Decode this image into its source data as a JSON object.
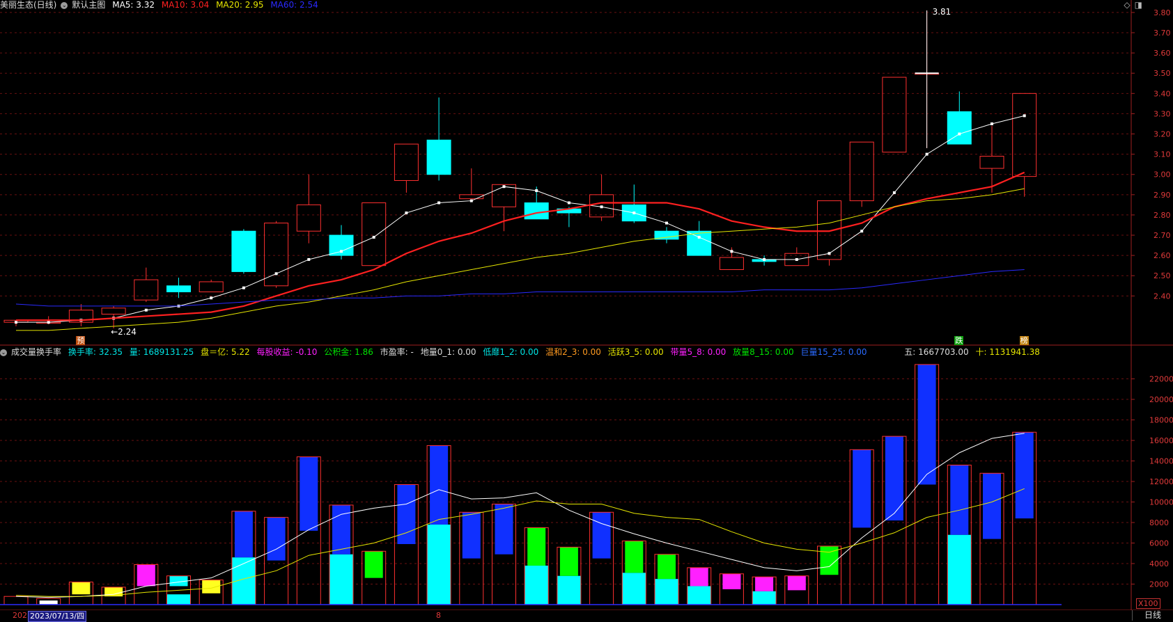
{
  "header": {
    "title": "美丽生态(日线)",
    "main_chart_label": "默认主图",
    "ma": [
      {
        "label": "MA5: 3.32",
        "color": "#ffffff"
      },
      {
        "label": "MA10: 3.04",
        "color": "#ff2020"
      },
      {
        "label": "MA20: 2.95",
        "color": "#e6e600"
      },
      {
        "label": "MA60: 2.54",
        "color": "#2a2aff"
      }
    ]
  },
  "volume_header": {
    "title": "成交量换手率",
    "items": [
      {
        "label": "换手率: 32.35",
        "color": "#00e5e5"
      },
      {
        "label": "量: 1689131.25",
        "color": "#00e5e5"
      },
      {
        "label": "盘＝亿: 5.22",
        "color": "#e6e600"
      },
      {
        "label": "每股收益: -0.10",
        "color": "#ff20ff"
      },
      {
        "label": "公积金: 1.86",
        "color": "#00e500"
      },
      {
        "label": "市盈率: -",
        "color": "#dddddd"
      },
      {
        "label": "地量0_1: 0.00",
        "color": "#dddddd"
      },
      {
        "label": "低靡1_2: 0.00",
        "color": "#00e5e5"
      },
      {
        "label": "温和2_3: 0.00",
        "color": "#ff9a20"
      },
      {
        "label": "活跃3_5: 0.00",
        "color": "#e6e600"
      },
      {
        "label": "带量5_8: 0.00",
        "color": "#ff20ff"
      },
      {
        "label": "放量8_15: 0.00",
        "color": "#00e500"
      },
      {
        "label": "巨量15_25: 0.00",
        "color": "#2a6aff"
      }
    ],
    "extra": [
      {
        "label": "五: 1667703.00",
        "color": "#dddddd"
      },
      {
        "label": "十: 1131941.38",
        "color": "#e6e600"
      }
    ]
  },
  "bottom": {
    "date": "2023/07/13/四",
    "left_partial": "202",
    "mid_mark": "8",
    "daily": "日线",
    "multiplier": "X100"
  },
  "markers": [
    {
      "text": "预",
      "bg": "#c05010",
      "index": 2
    },
    {
      "text": "跌",
      "bg": "#10a010",
      "index": 29
    },
    {
      "text": "榜",
      "bg": "#c08010",
      "index": 31
    }
  ],
  "chart_data": [
    {
      "type": "candlestick",
      "y_ticks": [
        2.4,
        2.5,
        2.6,
        2.7,
        2.8,
        2.9,
        3.0,
        3.1,
        3.2,
        3.3,
        3.4,
        3.5,
        3.6,
        3.7,
        3.8
      ],
      "ylim": [
        2.24,
        3.84
      ],
      "annotations": [
        {
          "text": "3.81",
          "index": 28
        },
        {
          "text": "2.24",
          "index": 3
        }
      ],
      "candles": [
        {
          "o": 2.27,
          "c": 2.28,
          "h": 2.28,
          "l": 2.25
        },
        {
          "o": 2.27,
          "c": 2.27,
          "h": 2.3,
          "l": 2.26
        },
        {
          "o": 2.27,
          "c": 2.33,
          "h": 2.36,
          "l": 2.25
        },
        {
          "o": 2.31,
          "c": 2.34,
          "h": 2.35,
          "l": 2.24
        },
        {
          "o": 2.38,
          "c": 2.48,
          "h": 2.54,
          "l": 2.37
        },
        {
          "o": 2.45,
          "c": 2.42,
          "h": 2.49,
          "l": 2.39
        },
        {
          "o": 2.42,
          "c": 2.47,
          "h": 2.48,
          "l": 2.42
        },
        {
          "o": 2.72,
          "c": 2.52,
          "h": 2.73,
          "l": 2.51
        },
        {
          "o": 2.45,
          "c": 2.76,
          "h": 2.77,
          "l": 2.44
        },
        {
          "o": 2.72,
          "c": 2.85,
          "h": 3.0,
          "l": 2.66
        },
        {
          "o": 2.7,
          "c": 2.6,
          "h": 2.75,
          "l": 2.58
        },
        {
          "o": 2.55,
          "c": 2.86,
          "h": 2.86,
          "l": 2.55
        },
        {
          "o": 2.97,
          "c": 3.15,
          "h": 3.15,
          "l": 2.91
        },
        {
          "o": 3.17,
          "c": 3.0,
          "h": 3.38,
          "l": 2.97
        },
        {
          "o": 2.88,
          "c": 2.9,
          "h": 3.03,
          "l": 2.88
        },
        {
          "o": 2.84,
          "c": 2.95,
          "h": 2.95,
          "l": 2.72
        },
        {
          "o": 2.86,
          "c": 2.78,
          "h": 2.94,
          "l": 2.78
        },
        {
          "o": 2.83,
          "c": 2.81,
          "h": 2.84,
          "l": 2.74
        },
        {
          "o": 2.79,
          "c": 2.9,
          "h": 3.0,
          "l": 2.77
        },
        {
          "o": 2.85,
          "c": 2.77,
          "h": 2.95,
          "l": 2.76
        },
        {
          "o": 2.72,
          "c": 2.68,
          "h": 2.74,
          "l": 2.66
        },
        {
          "o": 2.72,
          "c": 2.6,
          "h": 2.77,
          "l": 2.6
        },
        {
          "o": 2.53,
          "c": 2.59,
          "h": 2.64,
          "l": 2.53
        },
        {
          "o": 2.58,
          "c": 2.57,
          "h": 2.6,
          "l": 2.55
        },
        {
          "o": 2.55,
          "c": 2.61,
          "h": 2.64,
          "l": 2.55
        },
        {
          "o": 2.58,
          "c": 2.87,
          "h": 2.87,
          "l": 2.55
        },
        {
          "o": 2.87,
          "c": 3.16,
          "h": 3.16,
          "l": 2.84
        },
        {
          "o": 3.11,
          "c": 3.48,
          "h": 3.48,
          "l": 3.11
        },
        {
          "o": 3.5,
          "c": 3.5,
          "h": 3.81,
          "l": 3.13
        },
        {
          "o": 3.31,
          "c": 3.15,
          "h": 3.41,
          "l": 3.15
        },
        {
          "o": 3.03,
          "c": 3.09,
          "h": 3.24,
          "l": 2.91
        },
        {
          "o": 2.99,
          "c": 3.4,
          "h": 3.4,
          "l": 2.89
        }
      ],
      "series": [
        {
          "name": "MA5",
          "color": "#ffffff",
          "values": [
            2.27,
            2.27,
            2.28,
            2.29,
            2.33,
            2.35,
            2.39,
            2.44,
            2.51,
            2.58,
            2.62,
            2.69,
            2.81,
            2.86,
            2.87,
            2.94,
            2.92,
            2.86,
            2.84,
            2.81,
            2.76,
            2.69,
            2.62,
            2.58,
            2.58,
            2.61,
            2.72,
            2.91,
            3.1,
            3.2,
            3.25,
            3.29
          ]
        },
        {
          "name": "MA10",
          "color": "#ff2020",
          "values": [
            2.28,
            2.28,
            2.28,
            2.29,
            2.3,
            2.31,
            2.32,
            2.35,
            2.4,
            2.45,
            2.48,
            2.53,
            2.61,
            2.67,
            2.71,
            2.77,
            2.81,
            2.83,
            2.86,
            2.86,
            2.86,
            2.83,
            2.77,
            2.74,
            2.72,
            2.72,
            2.76,
            2.84,
            2.88,
            2.91,
            2.94,
            3.01
          ]
        },
        {
          "name": "MA20",
          "color": "#e6e600",
          "values": [
            2.23,
            2.23,
            2.24,
            2.25,
            2.26,
            2.27,
            2.29,
            2.32,
            2.35,
            2.37,
            2.4,
            2.43,
            2.47,
            2.5,
            2.53,
            2.56,
            2.59,
            2.61,
            2.64,
            2.67,
            2.69,
            2.71,
            2.72,
            2.73,
            2.74,
            2.76,
            2.8,
            2.84,
            2.87,
            2.88,
            2.9,
            2.93
          ]
        },
        {
          "name": "MA60",
          "color": "#2a2aff",
          "values": [
            2.36,
            2.35,
            2.35,
            2.35,
            2.35,
            2.35,
            2.36,
            2.37,
            2.38,
            2.38,
            2.39,
            2.39,
            2.4,
            2.4,
            2.41,
            2.41,
            2.42,
            2.42,
            2.42,
            2.42,
            2.42,
            2.42,
            2.42,
            2.43,
            2.43,
            2.43,
            2.44,
            2.46,
            2.48,
            2.5,
            2.52,
            2.53
          ]
        }
      ]
    },
    {
      "type": "bar",
      "y_ticks": [
        2000,
        4000,
        6000,
        8000,
        10000,
        12000,
        14000,
        16000,
        18000,
        20000,
        22000
      ],
      "ylim": [
        0,
        23800
      ],
      "bars": [
        {
          "v": 800,
          "inner": [
            0,
            500
          ],
          "fill": "#000000"
        },
        {
          "v": 600,
          "inner": [
            0,
            400
          ],
          "fill": "#ffffff"
        },
        {
          "v": 2200,
          "inner": [
            1000,
            2200
          ],
          "fill": "#ffff20"
        },
        {
          "v": 1700,
          "inner": [
            800,
            1700
          ],
          "fill": "#ffff20"
        },
        {
          "v": 3900,
          "inner": [
            1800,
            3900
          ],
          "fill": "#ff20ff"
        },
        {
          "v": 2800,
          "cyan": 1000,
          "inner": [
            1800,
            2800
          ],
          "fill": "#00ffff"
        },
        {
          "v": 2400,
          "inner": [
            1100,
            2400
          ],
          "fill": "#ffff20"
        },
        {
          "v": 9100,
          "cyan": 4600,
          "inner": [
            4600,
            9100
          ],
          "fill": "#1030ff"
        },
        {
          "v": 8500,
          "inner": [
            4300,
            8500
          ],
          "fill": "#1030ff"
        },
        {
          "v": 14400,
          "inner": [
            7200,
            14400
          ],
          "fill": "#1030ff"
        },
        {
          "v": 9700,
          "cyan": 4900,
          "inner": [
            4900,
            9700
          ],
          "fill": "#1030ff"
        },
        {
          "v": 5200,
          "inner": [
            2600,
            5200
          ],
          "fill": "#00ff00"
        },
        {
          "v": 11700,
          "inner": [
            5900,
            11700
          ],
          "fill": "#1030ff"
        },
        {
          "v": 15500,
          "cyan": 7800,
          "inner": [
            7800,
            15500
          ],
          "fill": "#1030ff"
        },
        {
          "v": 9000,
          "inner": [
            4500,
            9000
          ],
          "fill": "#1030ff"
        },
        {
          "v": 9800,
          "inner": [
            4900,
            9800
          ],
          "fill": "#1030ff"
        },
        {
          "v": 7500,
          "cyan": 3800,
          "inner": [
            3800,
            7500
          ],
          "fill": "#00ff00"
        },
        {
          "v": 5600,
          "cyan": 2800,
          "inner": [
            2800,
            5600
          ],
          "fill": "#00ff00"
        },
        {
          "v": 9000,
          "inner": [
            4500,
            9000
          ],
          "fill": "#1030ff"
        },
        {
          "v": 6200,
          "cyan": 3100,
          "inner": [
            3100,
            6200
          ],
          "fill": "#00ff00"
        },
        {
          "v": 4900,
          "cyan": 2500,
          "inner": [
            2500,
            4900
          ],
          "fill": "#00ff00"
        },
        {
          "v": 3600,
          "cyan": 1800,
          "inner": [
            1800,
            3600
          ],
          "fill": "#ff20ff"
        },
        {
          "v": 3000,
          "inner": [
            1500,
            3000
          ],
          "fill": "#ff20ff"
        },
        {
          "v": 2700,
          "cyan": 1300,
          "inner": [
            1300,
            2700
          ],
          "fill": "#ff20ff"
        },
        {
          "v": 2800,
          "inner": [
            1400,
            2800
          ],
          "fill": "#ff20ff"
        },
        {
          "v": 5700,
          "inner": [
            2900,
            5700
          ],
          "fill": "#00ff00"
        },
        {
          "v": 15100,
          "inner": [
            7500,
            15100
          ],
          "fill": "#1030ff"
        },
        {
          "v": 16400,
          "inner": [
            8200,
            16400
          ],
          "fill": "#1030ff"
        },
        {
          "v": 23400,
          "inner": [
            11700,
            23400
          ],
          "fill": "#1030ff"
        },
        {
          "v": 13600,
          "cyan": 6800,
          "inner": [
            6800,
            13600
          ],
          "fill": "#1030ff"
        },
        {
          "v": 12800,
          "inner": [
            6400,
            12800
          ],
          "fill": "#1030ff"
        },
        {
          "v": 16800,
          "inner": [
            8400,
            16800
          ],
          "fill": "#1030ff"
        }
      ],
      "series": [
        {
          "name": "五",
          "color": "#ffffff",
          "values": [
            800,
            700,
            800,
            1000,
            1800,
            2200,
            2600,
            4000,
            5400,
            7300,
            8800,
            9400,
            9800,
            11200,
            10300,
            10400,
            10900,
            9200,
            7900,
            6900,
            6000,
            5200,
            4400,
            3600,
            3300,
            3700,
            6500,
            8900,
            12700,
            14800,
            16200,
            16700
          ]
        },
        {
          "name": "十",
          "color": "#e6e600",
          "values": [
            900,
            800,
            800,
            900,
            1200,
            1400,
            1600,
            2500,
            3300,
            4800,
            5400,
            6000,
            7000,
            8300,
            8800,
            9400,
            10100,
            9800,
            9800,
            8900,
            8500,
            8300,
            7100,
            6000,
            5400,
            5100,
            6000,
            7000,
            8500,
            9200,
            10000,
            11300
          ]
        }
      ]
    }
  ]
}
